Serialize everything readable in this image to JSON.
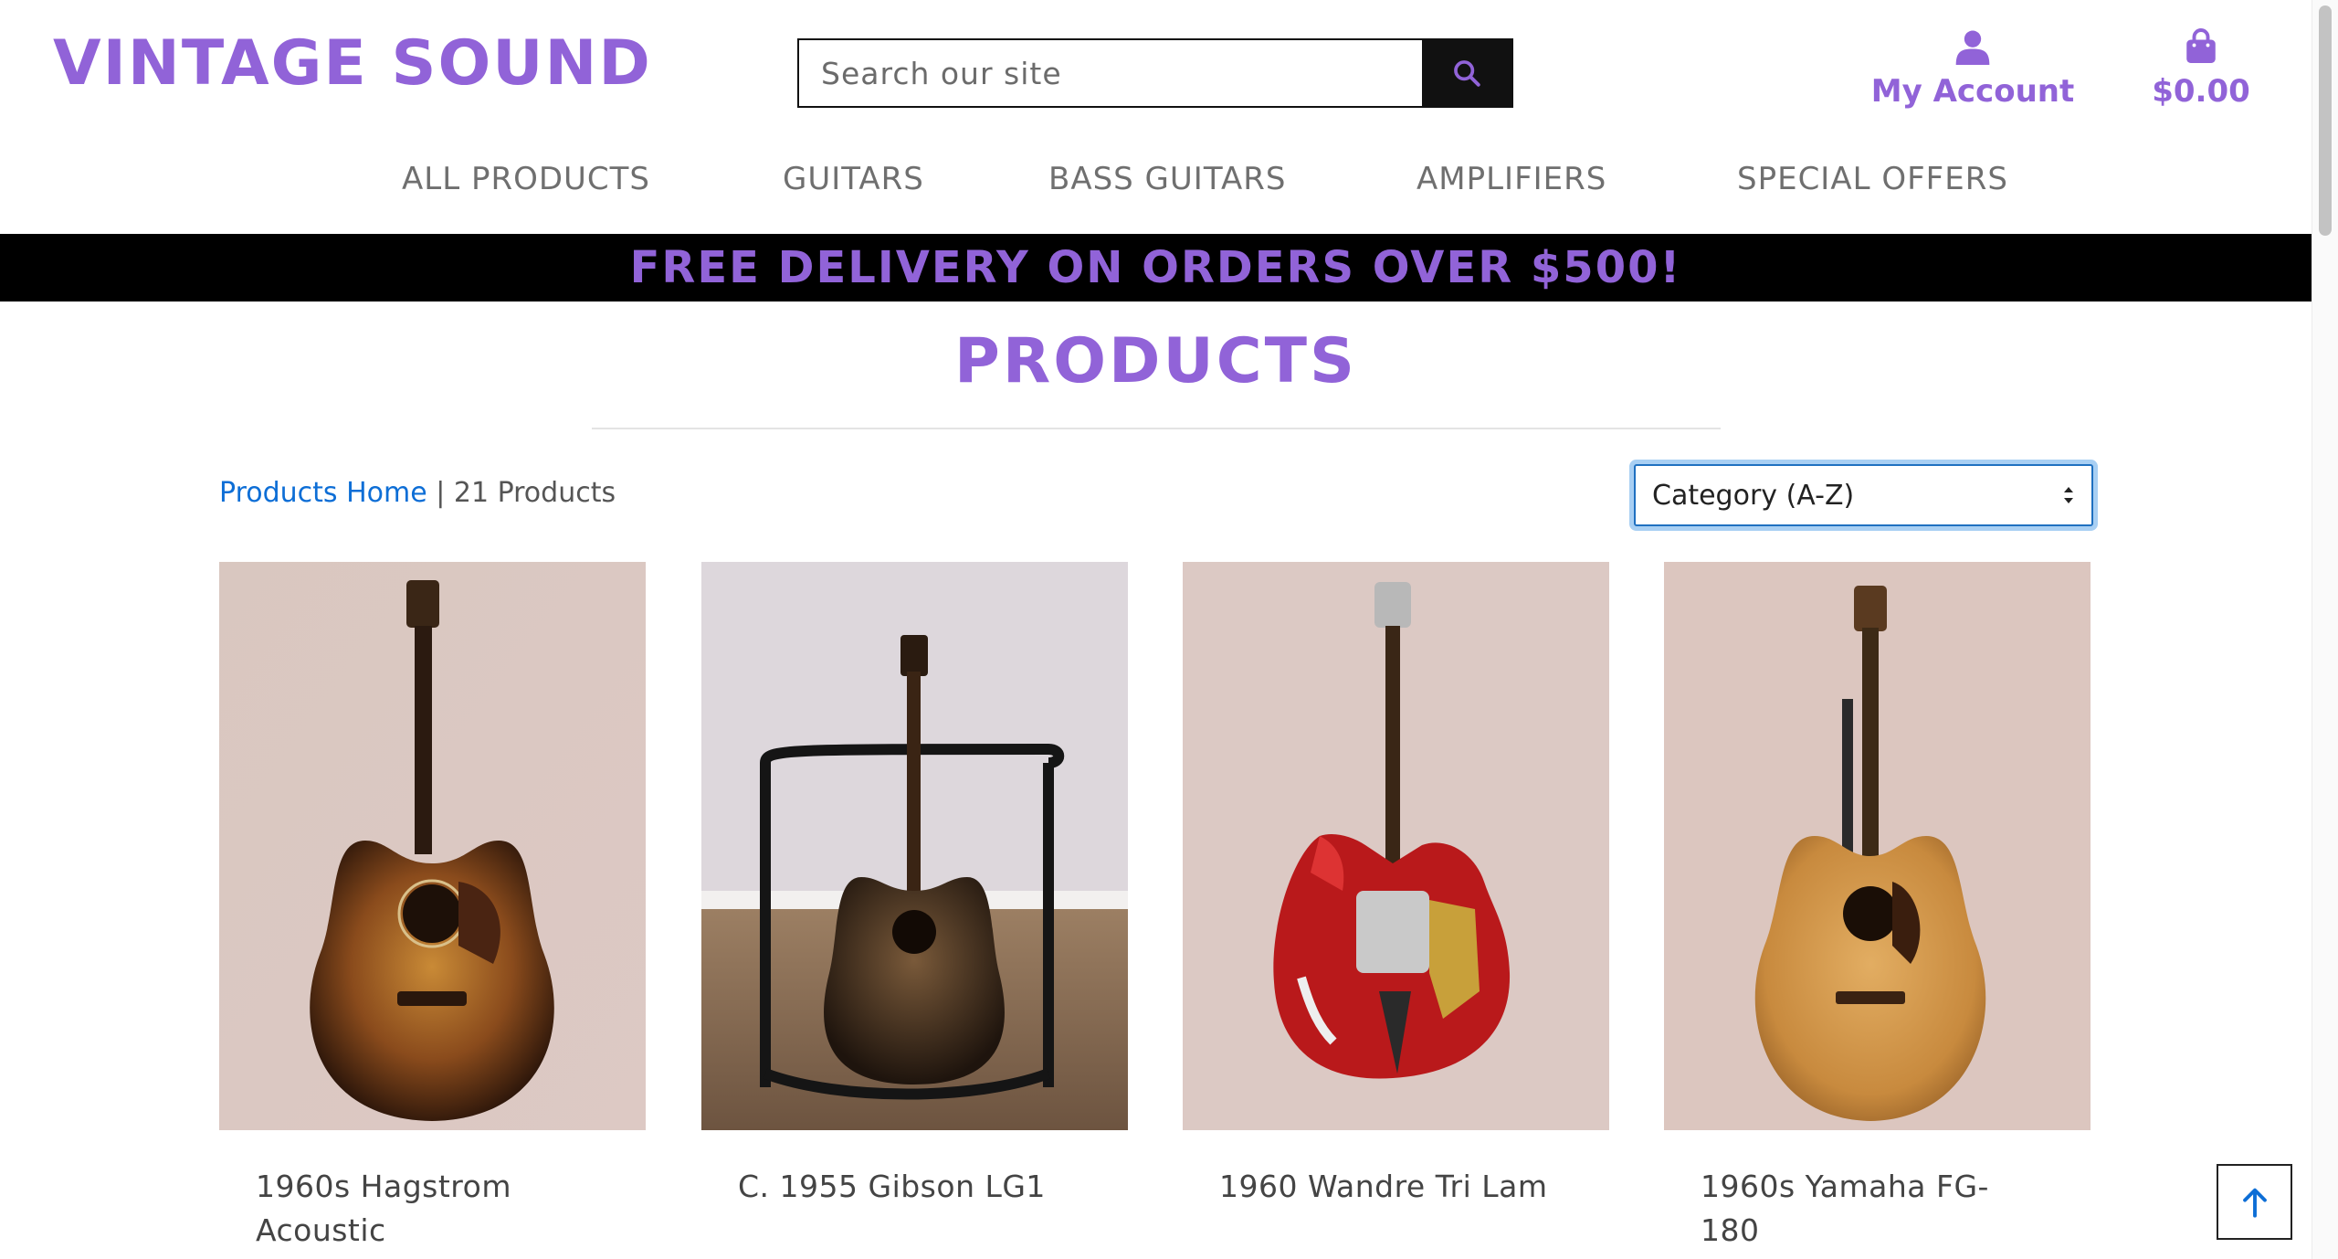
{
  "header": {
    "logo": "VINTAGE SOUND",
    "search_placeholder": "Search our site",
    "account_label": "My Account",
    "cart_total": "$0.00"
  },
  "nav": {
    "items": [
      {
        "label": "ALL PRODUCTS"
      },
      {
        "label": "GUITARS"
      },
      {
        "label": "BASS GUITARS"
      },
      {
        "label": "AMPLIFIERS"
      },
      {
        "label": "SPECIAL OFFERS"
      }
    ]
  },
  "banner": {
    "text": "FREE DELIVERY ON ORDERS OVER $500!"
  },
  "main": {
    "title": "PRODUCTS",
    "breadcrumb_link": "Products Home",
    "separator": " | ",
    "count_text": "21 Products",
    "sort_selected": "Category (A-Z)"
  },
  "products": [
    {
      "name": "1960s Hagstrom Acoustic",
      "image": "sunburst-acoustic-guitar"
    },
    {
      "name": "C. 1955 Gibson LG1",
      "image": "acoustic-guitar-on-stand"
    },
    {
      "name": "1960 Wandre Tri Lam",
      "image": "red-electric-guitar"
    },
    {
      "name": "1960s Yamaha FG-180",
      "image": "natural-acoustic-guitar"
    }
  ],
  "colors": {
    "brand": "#9163d8",
    "link": "#0d6ed6",
    "banner_bg": "#000000",
    "focus_ring": "#a8cff3"
  }
}
